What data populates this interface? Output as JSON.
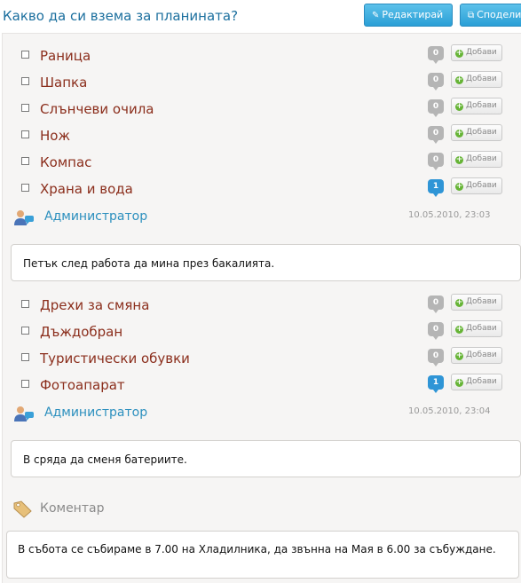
{
  "header": {
    "title": "Какво да си взема за планината?",
    "edit_label": "Редактирай",
    "share_label": "Сподели"
  },
  "groups": [
    {
      "items": [
        {
          "label": "Раница",
          "count": "0",
          "add_label": "Добави"
        },
        {
          "label": "Шапка",
          "count": "0",
          "add_label": "Добави"
        },
        {
          "label": "Слънчеви очила",
          "count": "0",
          "add_label": "Добави"
        },
        {
          "label": "Нож",
          "count": "0",
          "add_label": "Добави"
        },
        {
          "label": "Компас",
          "count": "0",
          "add_label": "Добави"
        },
        {
          "label": "Храна и вода",
          "count": "1",
          "add_label": "Добави"
        }
      ],
      "author": "Администратор",
      "timestamp": "10.05.2010, 23:03",
      "note": "Петък след работа да мина през бакалията."
    },
    {
      "items": [
        {
          "label": "Дрехи за смяна",
          "count": "0",
          "add_label": "Добави"
        },
        {
          "label": "Дъждобран",
          "count": "0",
          "add_label": "Добави"
        },
        {
          "label": "Туристически обувки",
          "count": "0",
          "add_label": "Добави"
        },
        {
          "label": "Фотоапарат",
          "count": "1",
          "add_label": "Добави"
        }
      ],
      "author": "Администратор",
      "timestamp": "10.05.2010, 23:04",
      "note": "В сряда да сменя батериите."
    }
  ],
  "comment": {
    "label": "Коментар",
    "text": "В събота се събираме в 7.00 на Хладилника, да звънна на Мая в 6.00 за събуждане."
  },
  "icons": {
    "edit": "pencil-icon",
    "share": "share-icon",
    "add": "plus-icon",
    "user": "user-comment-icon",
    "comment": "tag-icon"
  },
  "colors": {
    "title": "#1b6f9e",
    "item_label": "#8b2e1c",
    "author": "#2b8fbe",
    "button": "#2a9fd6",
    "count_zero": "#b5b5b5",
    "count_nonzero": "#2f95d6"
  }
}
